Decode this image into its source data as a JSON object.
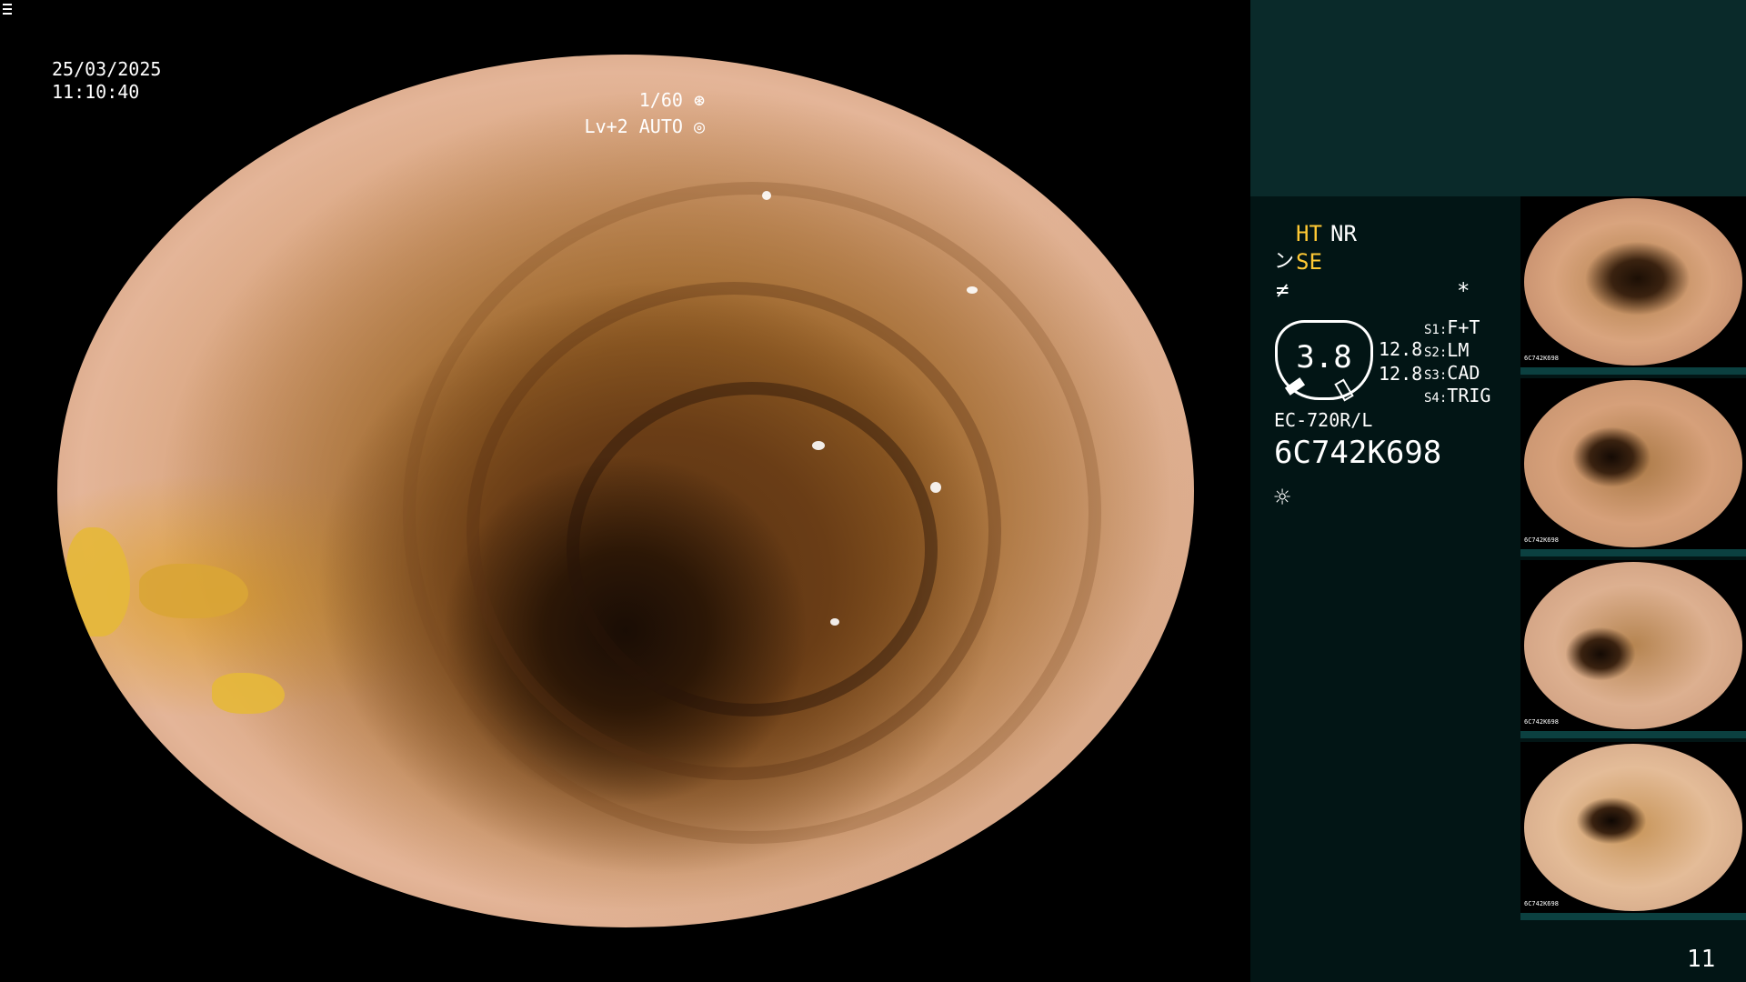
{
  "overlay": {
    "date": "25/03/2025",
    "time": "11:10:40",
    "shutter": "1/60",
    "shutter_icon": "shutter-icon",
    "level": "Lv+2 AUTO",
    "level_icon": "auto-iris-icon"
  },
  "status": {
    "ht": "HT",
    "nr": "NR",
    "se_icon_glyph": "ン",
    "se": "SE",
    "f_icon_glyph": "≠",
    "asterisk": "*"
  },
  "zoom": {
    "value": "3.8",
    "line1": "12.8",
    "line2": "12.8"
  },
  "switches": [
    {
      "key": "S1:",
      "value": "F+T"
    },
    {
      "key": "S2:",
      "value": "LM"
    },
    {
      "key": "S3:",
      "value": "CAD"
    },
    {
      "key": "S4:",
      "value": "TRIG"
    }
  ],
  "scope": {
    "model": "EC-720R/L",
    "serial": "6C742K698",
    "light_icon_glyph": "☼"
  },
  "thumbnails": [
    {
      "label": "6C742K698"
    },
    {
      "label": "6C742K698"
    },
    {
      "label": "6C742K698"
    },
    {
      "label": "6C742K698"
    }
  ],
  "page_number": "11",
  "colors": {
    "background": "#000000",
    "panel": "#021515",
    "panel_top": "#0a2a2a",
    "highlight_yellow": "#ffc934",
    "text": "#ffffff"
  }
}
